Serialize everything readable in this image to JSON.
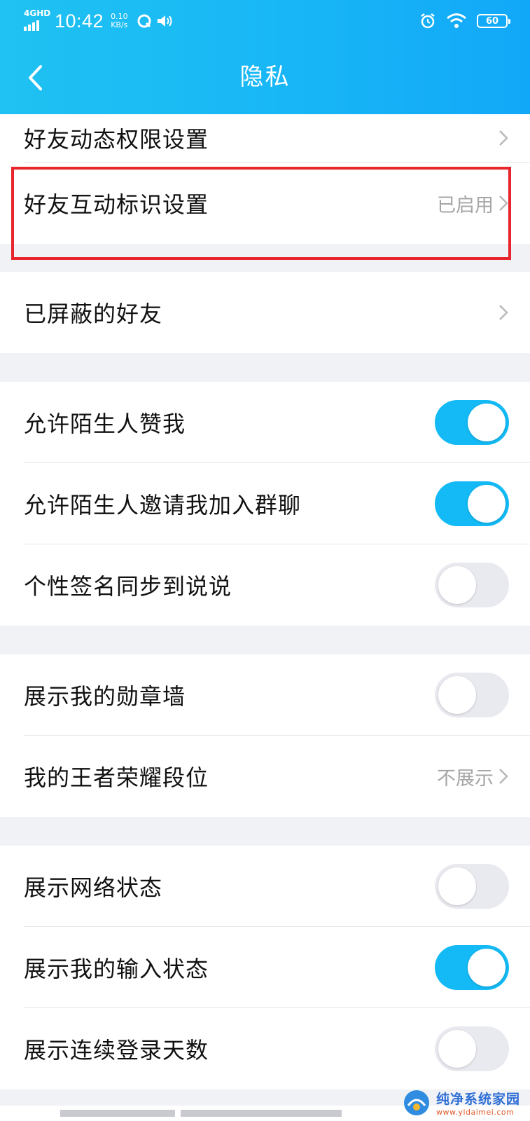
{
  "status_bar": {
    "network": "4GHD",
    "time": "10:42",
    "speed_value": "0.10",
    "speed_unit": "KB/s",
    "battery": "60"
  },
  "nav": {
    "title": "隐私"
  },
  "rows": {
    "moments_permission": {
      "label": "好友动态权限设置"
    },
    "interaction_badge": {
      "label": "好友互动标识设置",
      "value": "已启用"
    },
    "blocked_friends": {
      "label": "已屏蔽的好友"
    },
    "allow_stranger_likes": {
      "label": "允许陌生人赞我",
      "enabled": true
    },
    "allow_stranger_group_invite": {
      "label": "允许陌生人邀请我加入群聊",
      "enabled": true
    },
    "sync_signature": {
      "label": "个性签名同步到说说",
      "enabled": false
    },
    "show_medal_wall": {
      "label": "展示我的勋章墙",
      "enabled": false
    },
    "honor_of_kings_rank": {
      "label": "我的王者荣耀段位",
      "value": "不展示"
    },
    "show_network_status": {
      "label": "展示网络状态",
      "enabled": false
    },
    "show_typing_status": {
      "label": "展示我的输入状态",
      "enabled": true
    },
    "show_login_streak": {
      "label": "展示连续登录天数",
      "enabled": false
    }
  },
  "colors": {
    "header": "#18b6f6",
    "toggle_on": "#13baf5",
    "toggle_off": "#e9eaf0",
    "highlight": "#e8242c"
  },
  "watermark": {
    "title": "纯净系统家园",
    "url": "www.yidaimei.com"
  }
}
